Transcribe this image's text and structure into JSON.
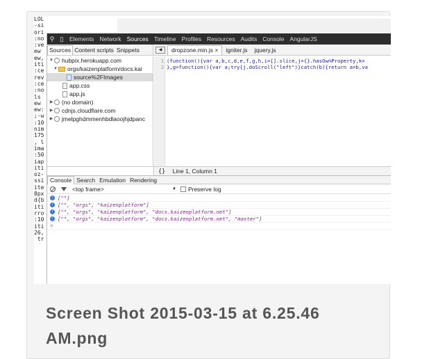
{
  "background_code_lines": [
    "LOL",
    "-si",
    "ori",
    ":no",
    ":ve",
    "ew",
    "ew,",
    "iti",
    ":ce",
    "rev",
    ":ce",
    ":no",
    "ls",
    "ew",
    "ew:",
    ";-w",
    ":10",
    "nim",
    "175",
    ", l",
    "ima",
    ":50",
    "iap",
    "iti",
    "oz-",
    "ssi",
    "ite",
    "8px",
    "d{b",
    "iti",
    "rro",
    ":10",
    "iti",
    "26,",
    " tr"
  ],
  "devtools": {
    "main_tabs": [
      "Elements",
      "Network",
      "Sources",
      "Timeline",
      "Profiles",
      "Resources",
      "Audits",
      "Console",
      "AngularJS"
    ],
    "active_main_tab": "Sources",
    "navigator_tabs": [
      "Sources",
      "Content scripts",
      "Snippets"
    ],
    "file_tabs": [
      "dropzone.min.js ×",
      "igniter.js",
      "jquery.js"
    ],
    "tree": [
      {
        "label": "hubpix.herokuapp.com",
        "kind": "globe",
        "indent": 0,
        "tri": "▼"
      },
      {
        "label": "orgs/kaizenplatform/docs.kai",
        "kind": "folder",
        "indent": 1,
        "tri": "▼"
      },
      {
        "label": "source%2FImages",
        "kind": "img",
        "indent": 3,
        "tri": "",
        "selected": true
      },
      {
        "label": "app.css",
        "kind": "css",
        "indent": 2,
        "tri": ""
      },
      {
        "label": "app.js",
        "kind": "js",
        "indent": 2,
        "tri": ""
      },
      {
        "label": "(no domain)",
        "kind": "globe",
        "indent": 0,
        "tri": "▶"
      },
      {
        "label": "cdnjs.cloudflare.com",
        "kind": "globe",
        "indent": 0,
        "tri": "▶"
      },
      {
        "label": "jmelpghdmmenhbdlaoojhjdpanc",
        "kind": "globe",
        "indent": 0,
        "tri": "▶"
      }
    ],
    "code_lines": [
      {
        "num": "1",
        "text": "(function(){var a,b,c,d,e,f,g,h,i=[].slice,j={}.hasOwnProperty,k="
      },
      {
        "num": "2",
        "text": "},g=function(){var a;try{j.doScroll(\"left\")}catch(b){return a=b,va"
      }
    ],
    "status": {
      "braces": "{}",
      "position": "Line 1, Column 1"
    },
    "drawer_tabs": [
      "Console",
      "Search",
      "Emulation",
      "Rendering"
    ],
    "console_bar": {
      "frame": "<top frame>",
      "preserve_log": "Preserve log"
    },
    "console_entries": [
      "[\"\"]",
      "[\"\", \"orgs\", \"kaizenplatform\"]",
      "[\"\", \"orgs\", \"kaizenplatform\", \"docs.kaizenplatform.net\"]",
      "[\"\", \"orgs\", \"kaizenplatform\", \"docs.kaizenplatform.net\", \"master\"]"
    ],
    "prompt": ">"
  },
  "caption": "Screen Shot 2015-03-15 at 6.25.46 AM.png",
  "colors": {
    "devtools_tab_bar": "#2d2d2d",
    "info_icon": "#3b76d8",
    "console_value": "#8b2291",
    "caption_text": "#555555"
  }
}
